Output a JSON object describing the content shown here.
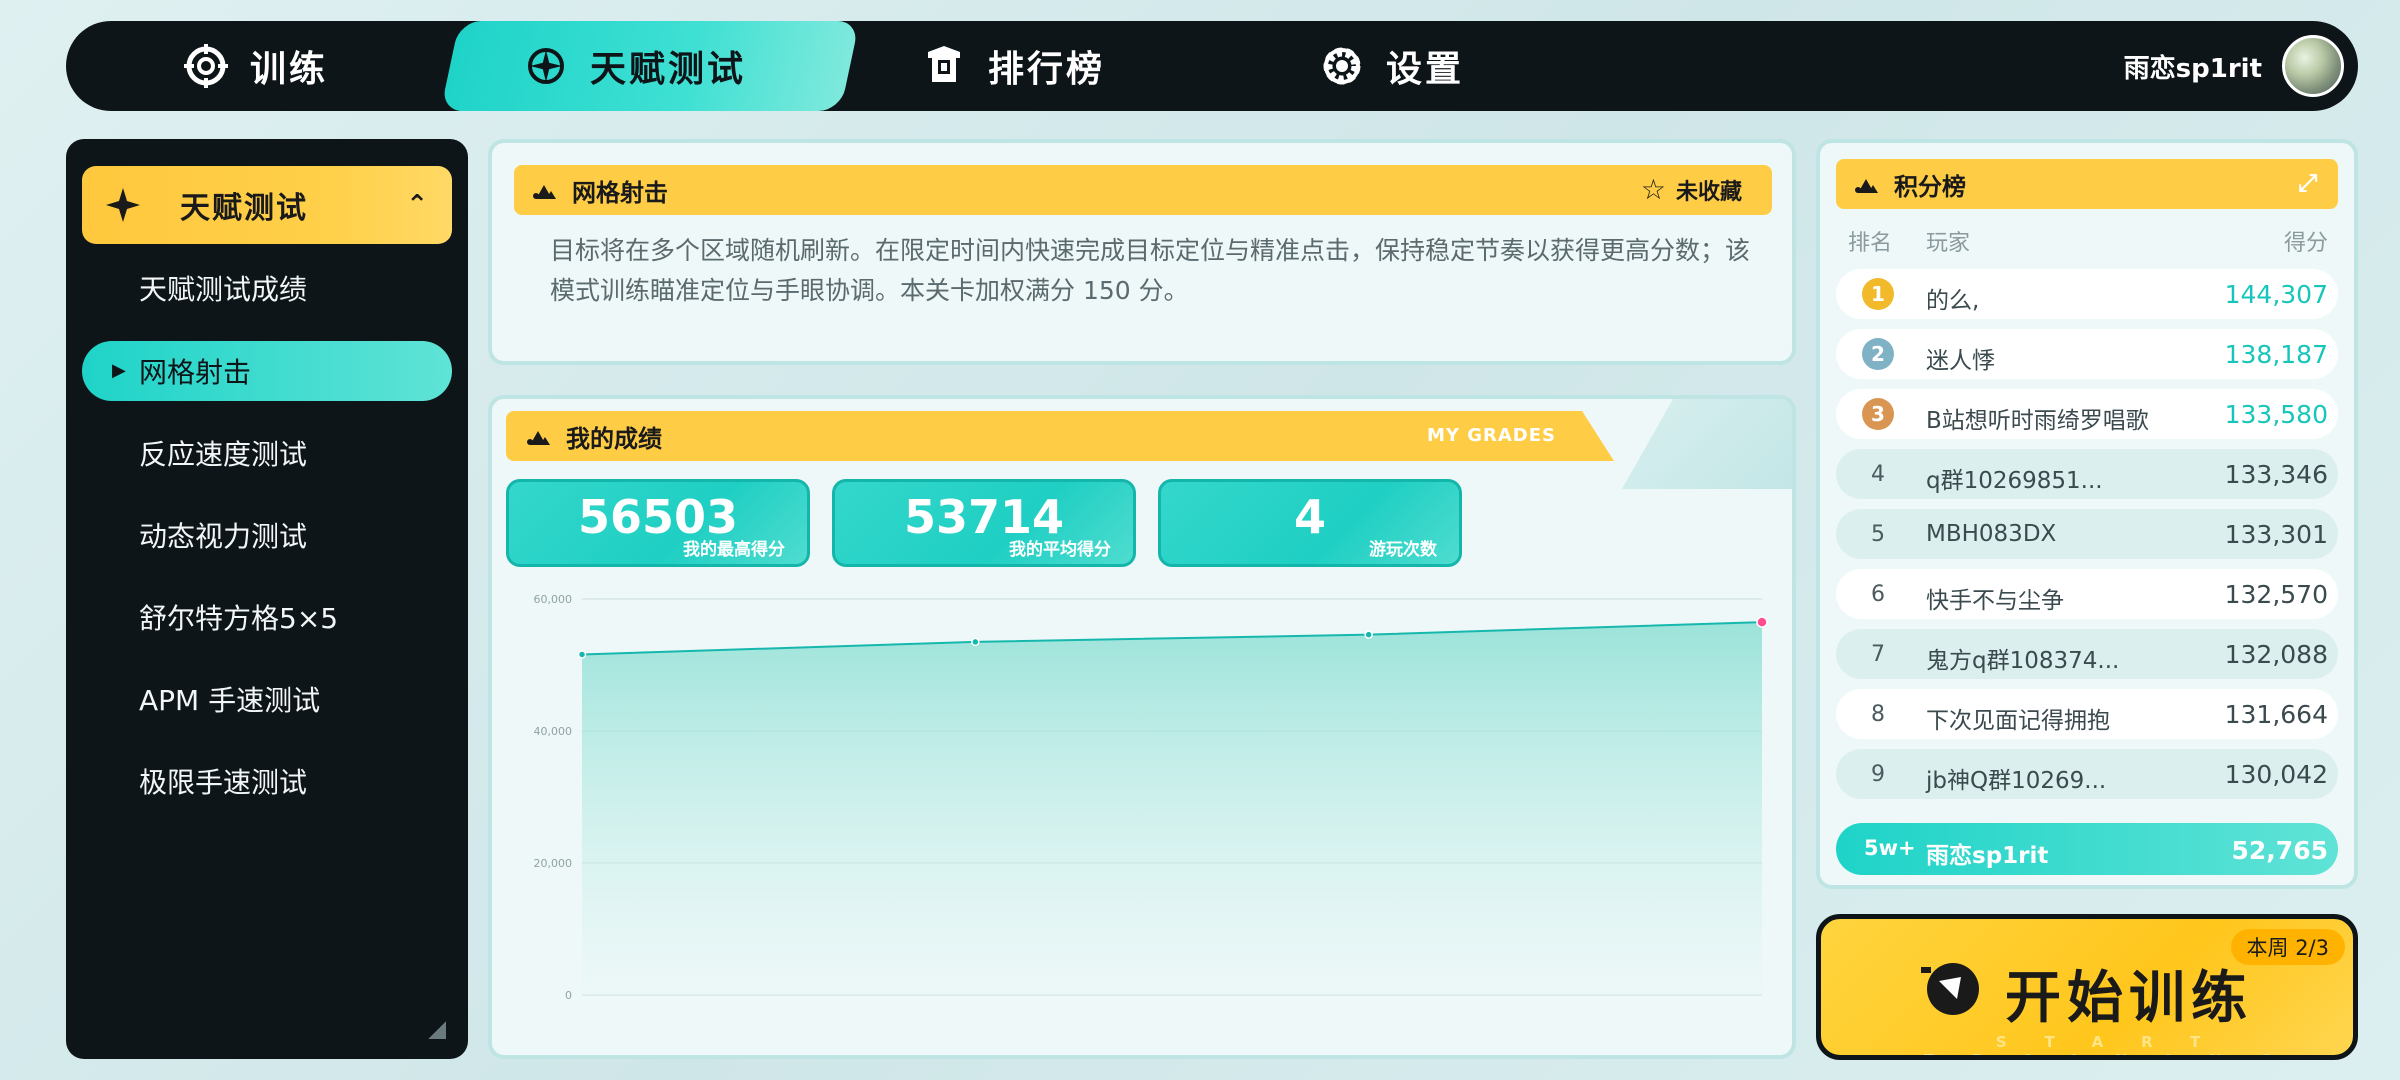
{
  "nav": {
    "tabs": [
      {
        "label": "训练",
        "icon": "crosshair-icon"
      },
      {
        "label": "天赋测试",
        "icon": "compass-icon",
        "active": true
      },
      {
        "label": "排行榜",
        "icon": "trophy-icon"
      },
      {
        "label": "设置",
        "icon": "gear-icon"
      }
    ],
    "username": "雨恋sp1rit"
  },
  "sidebar": {
    "header": "天赋测试",
    "items": [
      {
        "label": "天赋测试成绩"
      },
      {
        "label": "网格射击",
        "active": true
      },
      {
        "label": "反应速度测试"
      },
      {
        "label": "动态视力测试"
      },
      {
        "label": "舒尔特方格5×5"
      },
      {
        "label": "APM 手速测试"
      },
      {
        "label": "极限手速测试"
      }
    ]
  },
  "description": {
    "title": "网格射击",
    "favorite_label": "未收藏",
    "text": "目标将在多个区域随机刷新。在限定时间内快速完成目标定位与精准点击，保持稳定节奏以获得更高分数；该模式训练瞄准定位与手眼协调。本关卡加权满分 150 分。"
  },
  "grades": {
    "title": "我的成绩",
    "subtitle": "MY GRADES",
    "cards": [
      {
        "value": "56503",
        "label": "我的最高得分"
      },
      {
        "value": "53714",
        "label": "我的平均得分"
      },
      {
        "value": "4",
        "label": "游玩次数"
      }
    ]
  },
  "chart_data": {
    "type": "area",
    "y_ticks": [
      "60,000",
      "40,000",
      "20,000",
      "0"
    ],
    "ylim": [
      0,
      60000
    ],
    "values": [
      51600,
      53500,
      54600,
      56503
    ],
    "colors": {
      "line": "#16b8ad",
      "fill": "#6fd8cc",
      "last_point": "#ff4d8d"
    }
  },
  "leaderboard": {
    "title": "积分榜",
    "columns": {
      "rank": "排名",
      "player": "玩家",
      "score": "得分"
    },
    "rows": [
      {
        "rank": "1",
        "name": "的么,",
        "score": "144,307"
      },
      {
        "rank": "2",
        "name": "迷人悸",
        "score": "138,187"
      },
      {
        "rank": "3",
        "name": "B站想听时雨绮罗唱歌",
        "score": "133,580"
      },
      {
        "rank": "4",
        "name": "q群10269851...",
        "score": "133,346"
      },
      {
        "rank": "5",
        "name": "MBH083DX",
        "score": "133,301"
      },
      {
        "rank": "6",
        "name": "快手不与尘争",
        "score": "132,570"
      },
      {
        "rank": "7",
        "name": "鬼方q群108374...",
        "score": "132,088"
      },
      {
        "rank": "8",
        "name": "下次见面记得拥抱",
        "score": "131,664"
      },
      {
        "rank": "9",
        "name": "jb神Q群10269...",
        "score": "130,042"
      }
    ],
    "me": {
      "rank": "5w+",
      "name": "雨恋sp1rit",
      "score": "52,765"
    }
  },
  "start": {
    "label": "开始训练",
    "sub": "START TRAINING",
    "week_badge": "本周 2/3"
  },
  "colors": {
    "accent": "#1fd3c8",
    "yellow": "#ffcd45",
    "dark": "#0d1519"
  }
}
